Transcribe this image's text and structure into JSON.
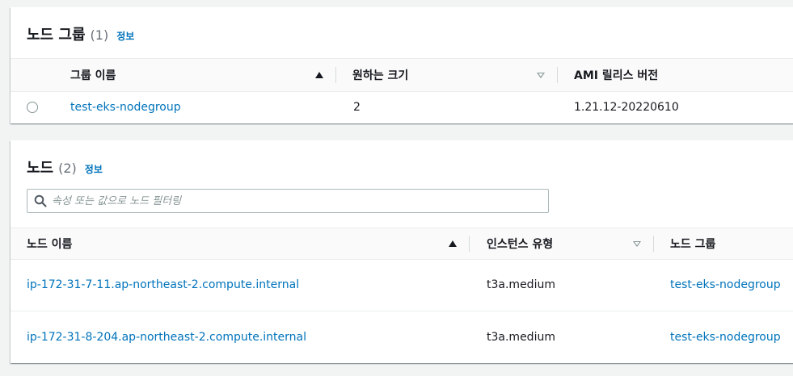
{
  "node_groups": {
    "title": "노드 그룹",
    "count": "(1)",
    "info": "정보",
    "columns": [
      "그룹 이름",
      "원하는 크기",
      "AMI 릴리스 버전"
    ],
    "rows": [
      {
        "name": "test-eks-nodegroup",
        "desired_size": "2",
        "ami_version": "1.21.12-20220610"
      }
    ]
  },
  "nodes": {
    "title": "노드",
    "count": "(2)",
    "info": "정보",
    "search_placeholder": "속성 또는 값으로 노드 필터링",
    "columns": [
      "노드 이름",
      "인스턴스 유형",
      "노드 그룹"
    ],
    "rows": [
      {
        "name": "ip-172-31-7-11.ap-northeast-2.compute.internal",
        "instance_type": "t3a.medium",
        "node_group": "test-eks-nodegroup"
      },
      {
        "name": "ip-172-31-8-204.ap-northeast-2.compute.internal",
        "instance_type": "t3a.medium",
        "node_group": "test-eks-nodegroup"
      }
    ]
  },
  "colors": {
    "link": "#0073bb",
    "text": "#16191f",
    "muted": "#687078",
    "background": "#f2f3f3"
  }
}
